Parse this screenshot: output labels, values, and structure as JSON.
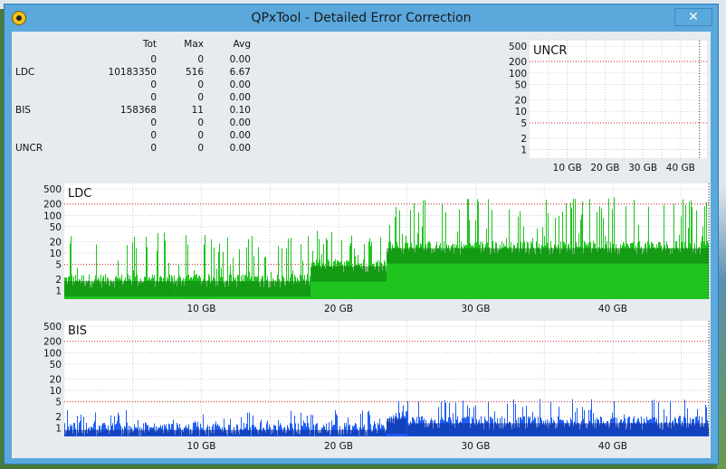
{
  "window": {
    "title": "QPxTool - Detailed Error Correction",
    "close_glyph": "✕"
  },
  "stats": {
    "headers": [
      "",
      "Tot",
      "Max",
      "Avg"
    ],
    "rows": [
      [
        "",
        "0",
        "0",
        "0.00"
      ],
      [
        "LDC",
        "10183350",
        "516",
        "6.67"
      ],
      [
        "",
        "0",
        "0",
        "0.00"
      ],
      [
        "",
        "0",
        "0",
        "0.00"
      ],
      [
        "BIS",
        "158368",
        "11",
        "0.10"
      ],
      [
        "",
        "0",
        "0",
        "0.00"
      ],
      [
        "",
        "0",
        "0",
        "0.00"
      ],
      [
        "UNCR",
        "0",
        "0",
        "0.00"
      ]
    ]
  },
  "colors": {
    "ldc_fill": "#1fc41f",
    "ldc_dark": "#0b7a0b",
    "bis_fill": "#1f5ff5",
    "bis_dark": "#0a2a90",
    "threshold": "#cc2222"
  },
  "chart_data": [
    {
      "type": "bar",
      "title": "UNCR",
      "x_unit": "GB",
      "xlim": [
        0,
        47
      ],
      "x_ticks": [
        "10 GB",
        "20 GB",
        "30 GB",
        "40 GB"
      ],
      "y_ticks": [
        "500",
        "200",
        "100",
        "50",
        "20",
        "10",
        "5",
        "2",
        "1"
      ],
      "yscale": "log",
      "ylim": [
        0.6,
        700
      ],
      "grid": true,
      "values": []
    },
    {
      "type": "bar",
      "title": "LDC",
      "x_unit": "GB",
      "xlim": [
        0,
        47
      ],
      "x_ticks": [
        "10 GB",
        "20 GB",
        "30 GB",
        "40 GB"
      ],
      "y_ticks": [
        "500",
        "200",
        "100",
        "50",
        "20",
        "10",
        "5",
        "2",
        "1"
      ],
      "yscale": "log",
      "ylim": [
        0.6,
        700
      ],
      "grid": true,
      "series": [
        {
          "segments": [
            {
              "x_from": 0,
              "x_to": 8,
              "base": 2,
              "peak": 40
            },
            {
              "x_from": 8,
              "x_to": 18,
              "base": 2,
              "peak": 30
            },
            {
              "x_from": 18,
              "x_to": 23.5,
              "base": 5,
              "peak": 40
            },
            {
              "x_from": 23.5,
              "x_to": 47,
              "base": 15,
              "peak": 300
            }
          ]
        }
      ]
    },
    {
      "type": "bar",
      "title": "BIS",
      "x_unit": "GB",
      "xlim": [
        0,
        47
      ],
      "x_ticks": [
        "10 GB",
        "20 GB",
        "30 GB",
        "40 GB"
      ],
      "y_ticks": [
        "500",
        "200",
        "100",
        "50",
        "20",
        "10",
        "5",
        "2",
        "1"
      ],
      "yscale": "log",
      "ylim": [
        0.6,
        700
      ],
      "grid": true,
      "series": [
        {
          "segments": [
            {
              "x_from": 0,
              "x_to": 23.5,
              "base": 1,
              "peak": 3
            },
            {
              "x_from": 23.5,
              "x_to": 25,
              "base": 2,
              "peak": 11
            },
            {
              "x_from": 25,
              "x_to": 47,
              "base": 1.5,
              "peak": 6
            }
          ]
        }
      ]
    }
  ]
}
